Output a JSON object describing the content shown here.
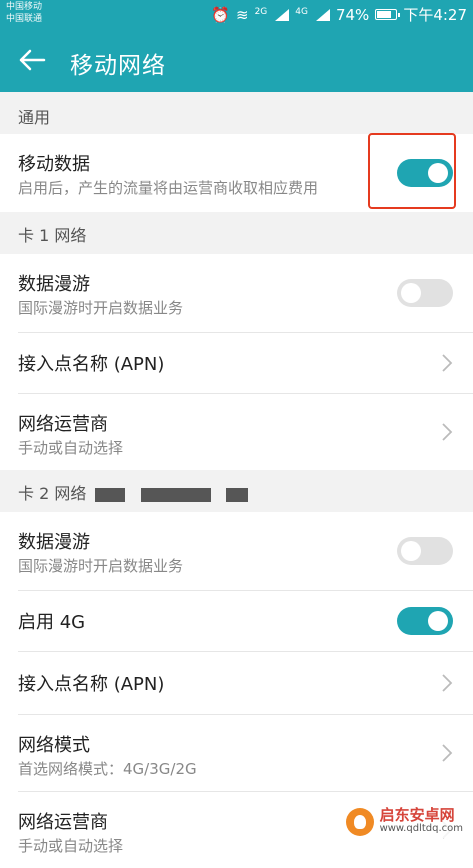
{
  "statusbar": {
    "carrier1": "中国移动",
    "carrier2": "中国联通",
    "net1": "2G",
    "net2": "4G",
    "battery": "74%",
    "time": "下午4:27"
  },
  "header": {
    "title": "移动网络"
  },
  "sections": {
    "general": "通用",
    "sim1": "卡 1 网络",
    "sim2": "卡 2 网络"
  },
  "general": {
    "mobile_data": {
      "label": "移动数据",
      "sub": "启用后，产生的流量将由运营商收取相应费用",
      "enabled": true
    }
  },
  "sim1": {
    "roaming": {
      "label": "数据漫游",
      "sub": "国际漫游时开启数据业务",
      "enabled": false
    },
    "apn": {
      "label": "接入点名称 (APN)"
    },
    "operator": {
      "label": "网络运营商",
      "sub": "手动或自动选择"
    }
  },
  "sim2": {
    "roaming": {
      "label": "数据漫游",
      "sub": "国际漫游时开启数据业务",
      "enabled": false
    },
    "lte": {
      "label": "启用 4G",
      "enabled": true
    },
    "apn": {
      "label": "接入点名称 (APN)"
    },
    "mode": {
      "label": "网络模式",
      "sub": "首选网络模式：4G/3G/2G"
    },
    "operator": {
      "label": "网络运营商",
      "sub": "手动或自动选择"
    }
  },
  "watermark": {
    "name": "启东安卓网",
    "url": "www.qdltdq.com"
  },
  "colors": {
    "accent": "#1fa5b2",
    "highlight": "#e53a1f"
  }
}
